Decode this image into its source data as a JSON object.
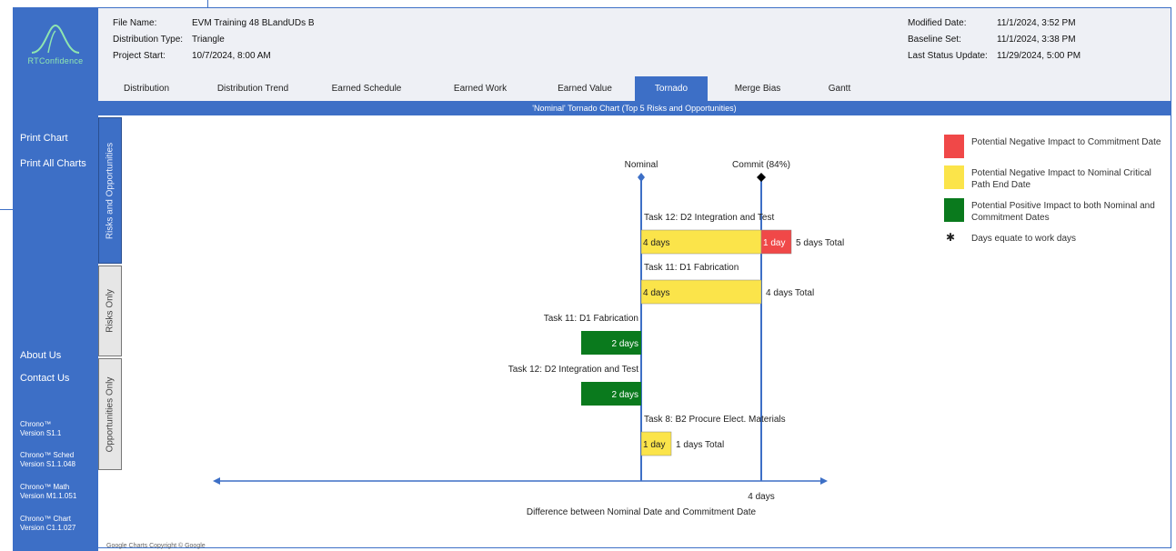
{
  "app": {
    "logo_text": "RTConfidence"
  },
  "sidebar": {
    "print_chart": "Print Chart",
    "print_all_charts": "Print All Charts",
    "about_us": "About Us",
    "contact_us": "Contact Us",
    "versions": [
      {
        "name": "Chrono™",
        "version": "Version S1.1"
      },
      {
        "name": "Chrono™ Sched",
        "version": "Version S1.1.048"
      },
      {
        "name": "Chrono™ Math",
        "version": "Version M1.1.051"
      },
      {
        "name": "Chrono™ Chart",
        "version": "Version C1.1.027"
      }
    ]
  },
  "header": {
    "file_name_label": "File Name:",
    "file_name": "EVM Training 48 BLandUDs B",
    "distribution_type_label": "Distribution Type:",
    "distribution_type": "Triangle",
    "project_start_label": "Project Start:",
    "project_start": "10/7/2024, 8:00 AM",
    "modified_date_label": "Modified Date:",
    "modified_date": "11/1/2024, 3:52 PM",
    "baseline_set_label": "Baseline Set:",
    "baseline_set": "11/1/2024, 3:38 PM",
    "last_status_label": "Last Status Update:",
    "last_status": "11/29/2024, 5:00 PM"
  },
  "tabs": [
    {
      "label": "Distribution",
      "active": false
    },
    {
      "label": "Distribution Trend",
      "active": false
    },
    {
      "label": "Earned Schedule",
      "active": false
    },
    {
      "label": "Earned Work",
      "active": false
    },
    {
      "label": "Earned Value",
      "active": false
    },
    {
      "label": "Tornado",
      "active": true
    },
    {
      "label": "Merge Bias",
      "active": false
    },
    {
      "label": "Gantt",
      "active": false
    }
  ],
  "side_tabs": [
    {
      "label": "Risks and Opportunities",
      "active": true
    },
    {
      "label": "Risks Only",
      "active": false
    },
    {
      "label": "Opportunities Only",
      "active": false
    }
  ],
  "chart_title": "'Nominal' Tornado Chart (Top 5 Risks and Opportunities)",
  "footer": "Google Charts Copyright © Google",
  "colors": {
    "accent": "#3d6fc6",
    "red": "#f04848",
    "yellow": "#fbe44a",
    "green": "#0a7a1d"
  },
  "legend": [
    {
      "color": "red",
      "text": "Potential Negative Impact to Commitment Date"
    },
    {
      "color": "yellow",
      "text": "Potential Negative Impact to Nominal Critical Path End Date"
    },
    {
      "color": "green",
      "text": "Potential Positive Impact to both Nominal and Commitment Dates"
    },
    {
      "color": "marker",
      "text": "Days equate to work days"
    }
  ],
  "chart_data": {
    "type": "bar",
    "nominal_label": "Nominal",
    "commit_label": "Commit (84%)",
    "commit_offset_days": 4,
    "axis_tick_label": "4 days",
    "xlabel": "Difference between Nominal Date and Commitment Date",
    "items": [
      {
        "task": "Task 12: D2 Integration and Test",
        "side": "right",
        "segments": [
          {
            "color": "yellow",
            "days": 4,
            "label": "4 days"
          },
          {
            "color": "red",
            "days": 1,
            "label": "1 day"
          }
        ],
        "total": "5 days Total"
      },
      {
        "task": "Task 11: D1 Fabrication",
        "side": "right",
        "segments": [
          {
            "color": "yellow",
            "days": 4,
            "label": "4 days"
          }
        ],
        "total": "4 days Total"
      },
      {
        "task": "Task 11: D1 Fabrication",
        "side": "left",
        "segments": [
          {
            "color": "green",
            "days": 2,
            "label": "2 days"
          }
        ],
        "total": ""
      },
      {
        "task": "Task 12: D2 Integration and Test",
        "side": "left",
        "segments": [
          {
            "color": "green",
            "days": 2,
            "label": "2 days"
          }
        ],
        "total": ""
      },
      {
        "task": "Task 8: B2 Procure Elect. Materials",
        "side": "right",
        "segments": [
          {
            "color": "yellow",
            "days": 1,
            "label": "1 day"
          }
        ],
        "total": "1 days Total"
      }
    ]
  }
}
